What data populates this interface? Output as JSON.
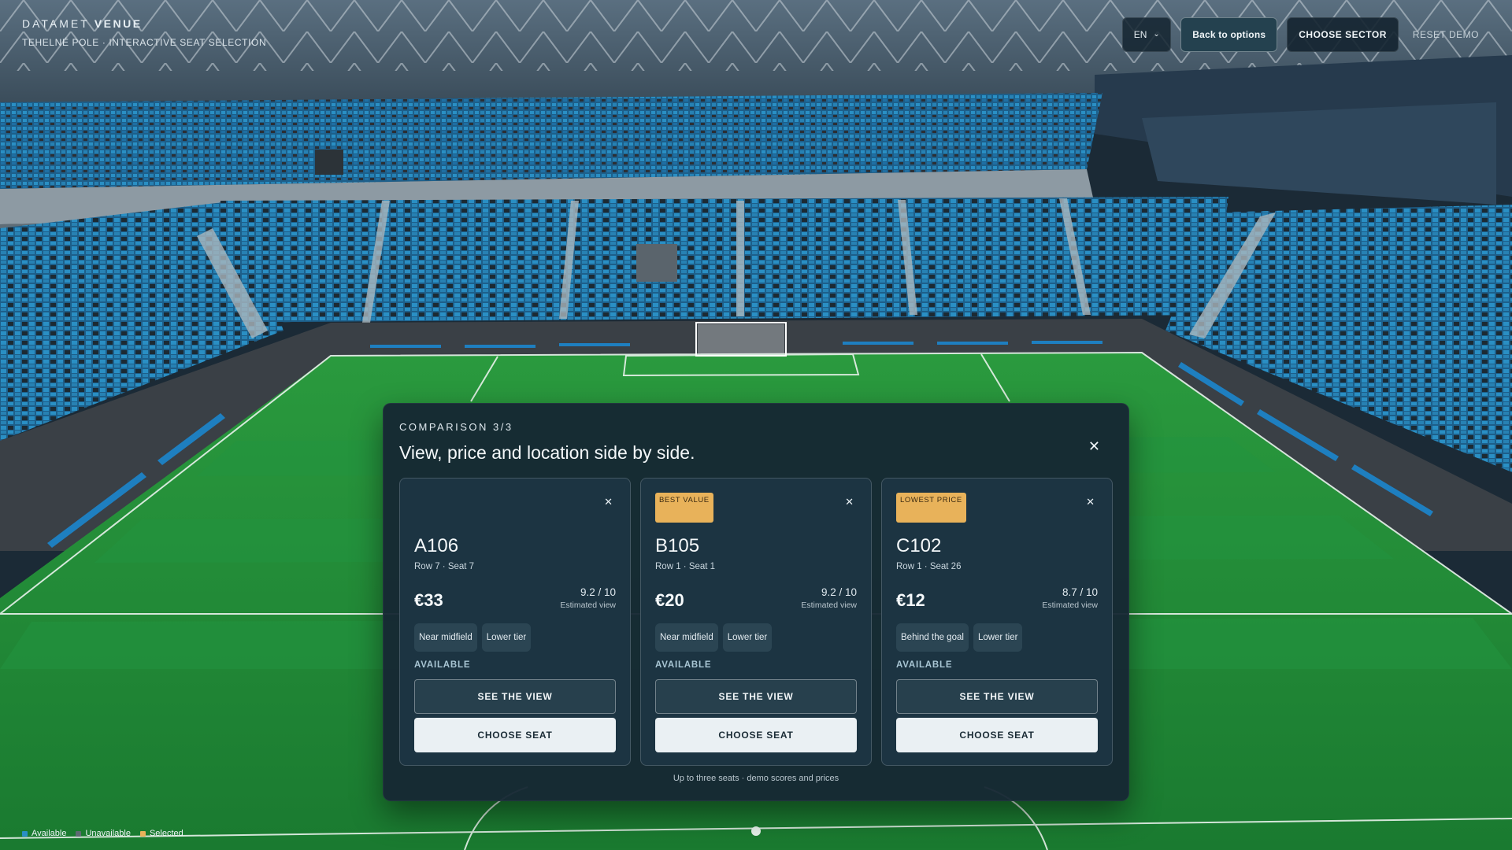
{
  "header": {
    "brand_light": "DATAMET",
    "brand_bold": "VENUE",
    "subtitle": "TEHELNÉ POLE · INTERACTIVE SEAT SELECTION"
  },
  "controls": {
    "language": "EN",
    "back_label": "Back to options",
    "choose_sector_label": "CHOOSE SECTOR",
    "reset_label": "RESET DEMO"
  },
  "modal": {
    "eyebrow": "COMPARISON 3/3",
    "title": "View, price and location side by side.",
    "close_icon": "✕",
    "footer": "Up to three seats · demo scores and prices",
    "cards": [
      {
        "badge": "",
        "sector": "A106",
        "row_seat": "Row 7 · Seat 7",
        "price": "€33",
        "score": "9.2 / 10",
        "score_label": "Estimated view",
        "tags": [
          "Near midfield",
          "Lower tier"
        ],
        "status": "AVAILABLE",
        "view_label": "SEE THE VIEW",
        "choose_label": "CHOOSE SEAT"
      },
      {
        "badge": "BEST VALUE",
        "sector": "B105",
        "row_seat": "Row 1 · Seat 1",
        "price": "€20",
        "score": "9.2 / 10",
        "score_label": "Estimated view",
        "tags": [
          "Near midfield",
          "Lower tier"
        ],
        "status": "AVAILABLE",
        "view_label": "SEE THE VIEW",
        "choose_label": "CHOOSE SEAT"
      },
      {
        "badge": "LOWEST PRICE",
        "sector": "C102",
        "row_seat": "Row 1 · Seat 26",
        "price": "€12",
        "score": "8.7 / 10",
        "score_label": "Estimated view",
        "tags": [
          "Behind the goal",
          "Lower tier"
        ],
        "status": "AVAILABLE",
        "view_label": "SEE THE VIEW",
        "choose_label": "CHOOSE SEAT"
      }
    ]
  },
  "legend": {
    "available": "Available",
    "unavailable": "Unavailable",
    "selected": "Selected",
    "available_color": "#2a8fc4",
    "unavailable_color": "#5e6a72",
    "selected_color": "#e8b25a"
  },
  "colors": {
    "pitch": "#1f8a3a",
    "seat": "#1f6fa3",
    "badge": "#e8b25a"
  }
}
